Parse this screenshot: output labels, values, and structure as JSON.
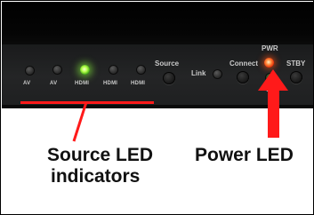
{
  "panel": {
    "source_labels": [
      "AV",
      "AV",
      "HDMI",
      "HDMI",
      "HDMI"
    ],
    "source_button_label": "Source",
    "link_label": "Link",
    "connect_label": "Connect",
    "pwr_label": "PWR",
    "stby_label": "STBY",
    "stby_partial_label": "ST",
    "active_source_index": 2
  },
  "annotations": {
    "source_led_caption_line1": "Source LED",
    "source_led_caption_line2": "indicators",
    "power_led_caption": "Power LED",
    "accent_color": "#ff1a1a"
  },
  "icons": {
    "source_leds": "led-indicator",
    "power_led": "led-indicator",
    "arrow": "arrow-up-icon"
  }
}
